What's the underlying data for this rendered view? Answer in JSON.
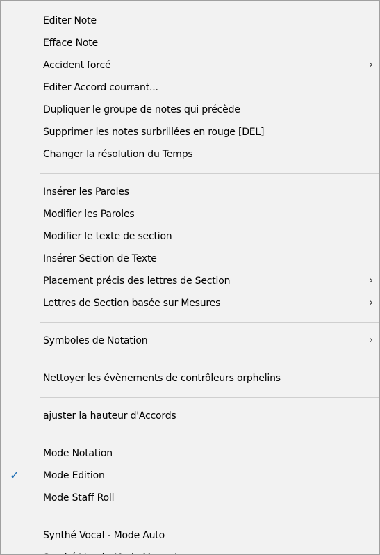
{
  "menu": {
    "groups": [
      {
        "items": [
          {
            "label": "Editer Note"
          },
          {
            "label": "Efface Note"
          },
          {
            "label": "Accident forcé",
            "submenu_arrow": "›"
          },
          {
            "label": "Editer Accord courrant..."
          },
          {
            "label": "Dupliquer le groupe de notes qui précède"
          },
          {
            "label": "Supprimer les notes surbrillées en rouge  [DEL]"
          },
          {
            "label": "Changer la résolution du Temps"
          }
        ]
      },
      {
        "items": [
          {
            "label": "Insérer les Paroles"
          },
          {
            "label": "Modifier les Paroles"
          },
          {
            "label": "Modifier le texte de section"
          },
          {
            "label": "Insérer Section de Texte"
          },
          {
            "label": "Placement précis des lettres de Section",
            "submenu_arrow": "›"
          },
          {
            "label": "Lettres de Section basée sur Mesures",
            "submenu_arrow": "›"
          }
        ]
      },
      {
        "items": [
          {
            "label": "Symboles de Notation",
            "submenu_arrow": "›"
          }
        ]
      },
      {
        "items": [
          {
            "label": "Nettoyer les évènements de contrôleurs orphelins"
          }
        ]
      },
      {
        "items": [
          {
            "label": "ajuster la hauteur d'Accords"
          }
        ]
      },
      {
        "items": [
          {
            "label": "Mode Notation"
          },
          {
            "label": "Mode Edition",
            "checked": true,
            "check_glyph": "✓"
          },
          {
            "label": "Mode Staff Roll"
          }
        ]
      },
      {
        "items": [
          {
            "label": "Synthé Vocal - Mode Auto"
          },
          {
            "label": "Synthé Vocal - Mode Manuel"
          }
        ]
      }
    ],
    "colors": {
      "background": "#f2f2f2",
      "border": "#a0a0a0",
      "separator": "#cfcfcf",
      "checkmark": "#1f6fb5"
    }
  }
}
